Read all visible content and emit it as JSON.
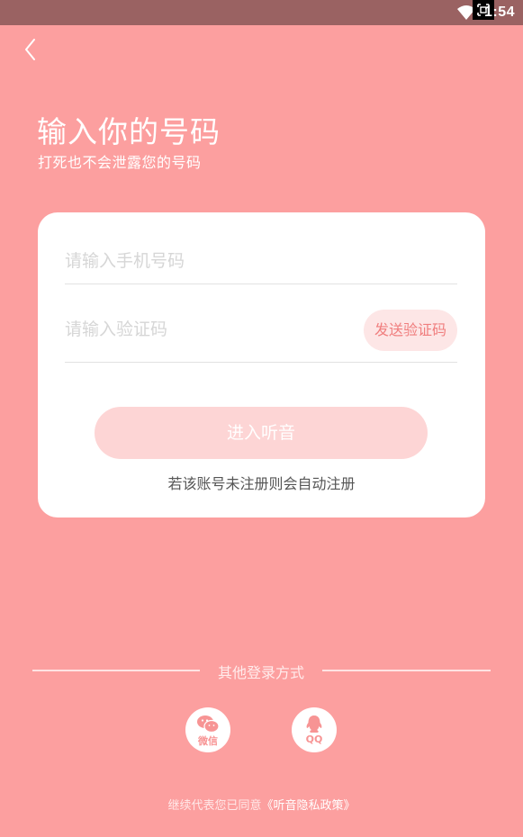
{
  "status_bar": {
    "time": "1:54",
    "wifi_icon": "wifi-icon",
    "screenshot_icon": "screenshot-icon"
  },
  "nav": {
    "back_icon": "chevron-left-icon"
  },
  "header": {
    "title": "输入你的号码",
    "subtitle": "打死也不会泄露您的号码"
  },
  "form": {
    "phone_placeholder": "请输入手机号码",
    "phone_value": "",
    "code_placeholder": "请输入验证码",
    "code_value": "",
    "send_code_label": "发送验证码",
    "submit_label": "进入听音",
    "register_note": "若该账号未注册则会自动注册"
  },
  "other_login": {
    "label": "其他登录方式",
    "wechat_label": "微信",
    "qq_label": "QQ",
    "wechat_icon": "wechat-icon",
    "qq_icon": "qq-penguin-icon"
  },
  "policy": {
    "prefix": "继续代表您已同意",
    "link": "《听音隐私政策》"
  },
  "colors": {
    "background": "#FC9F9F",
    "status_bar": "#9A6262",
    "accent": "#F07E7E",
    "submit_disabled": "#FDD5D5"
  }
}
